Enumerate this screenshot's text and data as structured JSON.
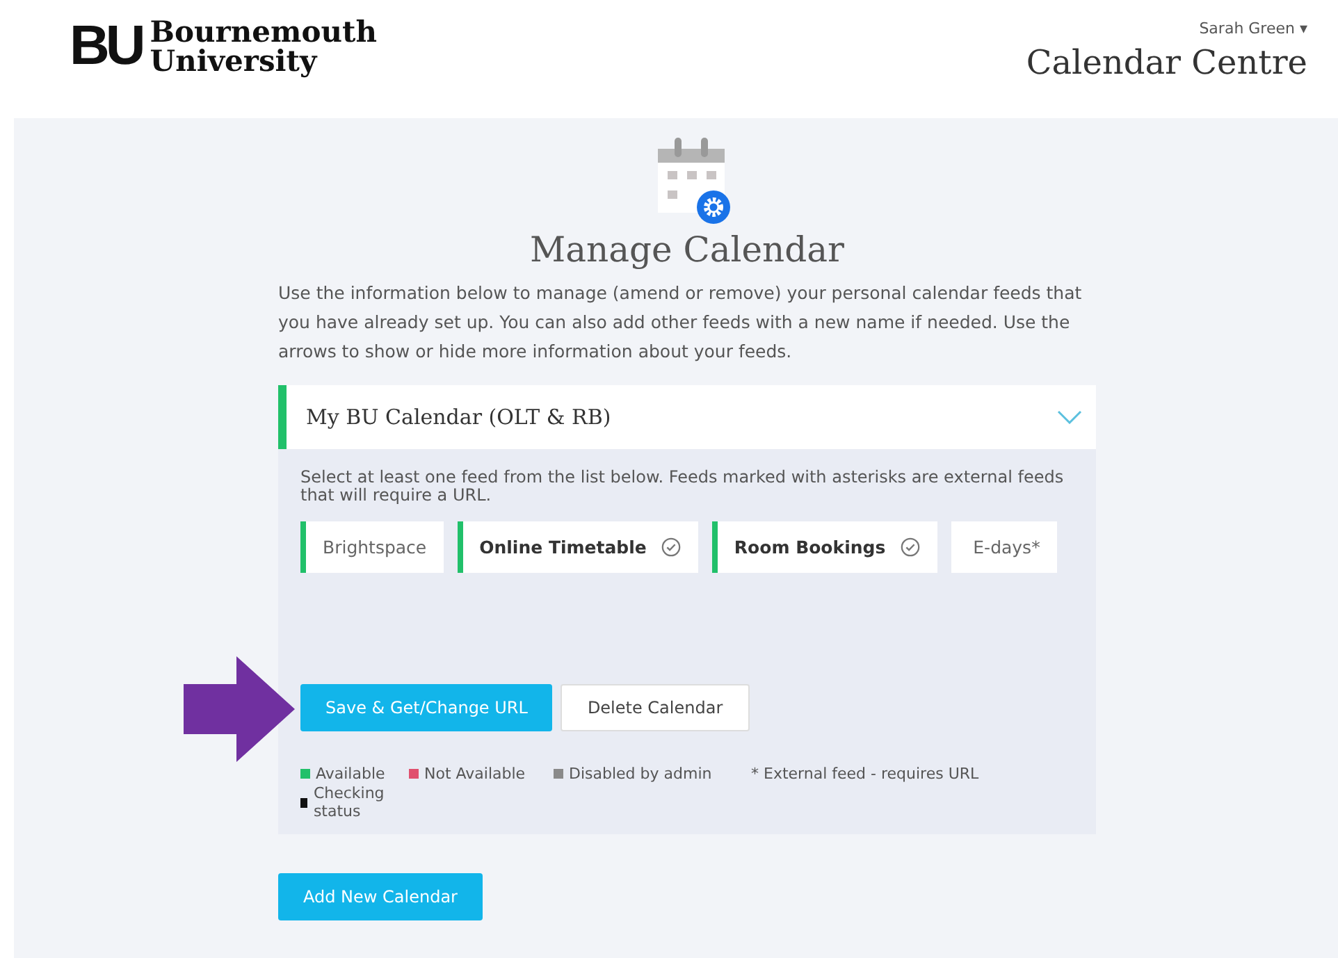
{
  "header": {
    "logo_mark": "BU",
    "logo_line1": "Bournemouth",
    "logo_line2": "University",
    "user": "Sarah Green",
    "user_caret": "▾",
    "app_title": "Calendar Centre"
  },
  "page": {
    "title": "Manage Calendar",
    "intro": "Use the information below to manage (amend or remove) your personal calendar feeds that you have already set up. You can also add other feeds with a new name if needed. Use the arrows to show or hide more information about your feeds."
  },
  "calendar": {
    "name": "My BU Calendar (OLT & RB)",
    "expanded": true,
    "hint": "Select at least one feed from the list below. Feeds marked with asterisks are external feeds that will require a URL.",
    "feeds": [
      {
        "label": "Brightspace",
        "selected": false,
        "color": "#21c06a"
      },
      {
        "label": "Online Timetable",
        "selected": true,
        "color": "#21c06a"
      },
      {
        "label": "Room Bookings",
        "selected": true,
        "color": "#21c06a"
      },
      {
        "label": "E-days*",
        "selected": false
      }
    ],
    "buttons": [
      {
        "label": "Save & Get/Change URL",
        "kind": "primary"
      },
      {
        "label": "Delete Calendar",
        "kind": "secondary"
      }
    ],
    "legend": [
      {
        "label": "Available",
        "color": "#21c06a"
      },
      {
        "label": "Not Available",
        "color": "#e0506e"
      },
      {
        "label": "Disabled by admin",
        "color": "#8a8a8a"
      },
      {
        "label": "* External feed - requires URL"
      },
      {
        "label": "Checking status",
        "color": "#111111"
      }
    ]
  },
  "add_button": "Add New Calendar"
}
